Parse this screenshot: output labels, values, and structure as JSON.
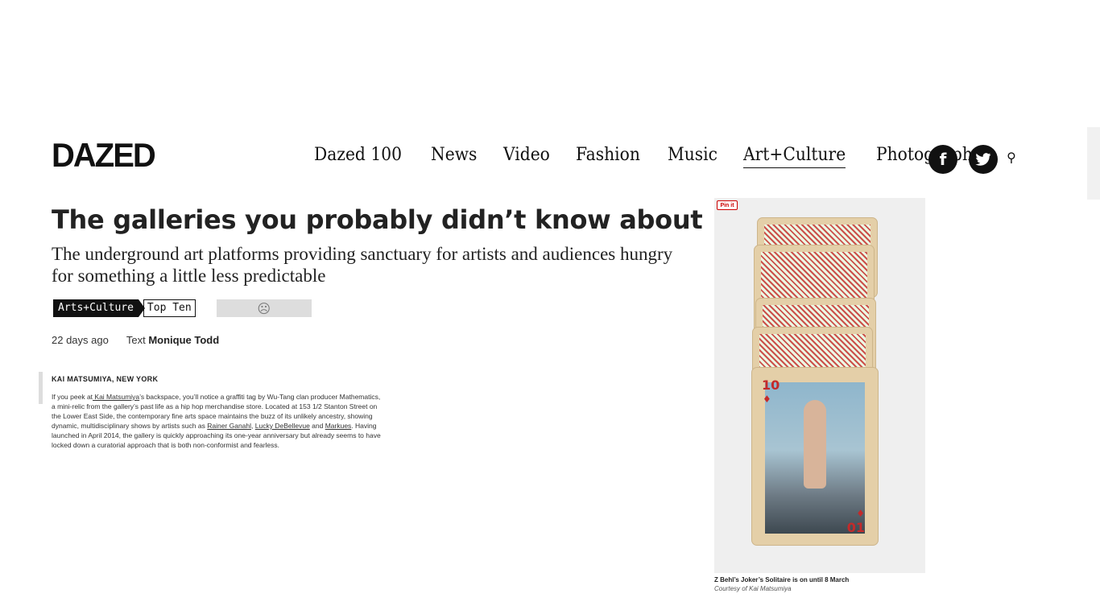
{
  "header": {
    "logo": "DAZED",
    "nav": [
      {
        "label": "Dazed 100",
        "active": false
      },
      {
        "label": "News",
        "active": false
      },
      {
        "label": "Video",
        "active": false
      },
      {
        "label": "Fashion",
        "active": false
      },
      {
        "label": "Music",
        "active": false
      },
      {
        "label": "Art+Culture",
        "active": true
      },
      {
        "label": "Photography",
        "active": false
      }
    ],
    "facebook_glyph": "f",
    "twitter_glyph": "🐦",
    "search_glyph": "⚲"
  },
  "article": {
    "headline": "The galleries you probably didn’t know about",
    "dek": "The underground art platforms providing sanctuary for artists and audiences hungry for something a little less predictable",
    "tags": {
      "primary": "Arts+Culture",
      "secondary": "Top Ten"
    },
    "ad_glyph": "☹",
    "meta": {
      "age": "22 days ago",
      "text_label": "Text",
      "author": "Monique Todd"
    },
    "section_heading": "KAI MATSUMIYA, NEW YORK",
    "body": {
      "p1": "If you peek at",
      "link1": " Kai Matsumiya",
      "p2": "’s backspace, you’ll notice a graffiti tag by Wu-Tang clan producer Mathematics, a mini-relic from the gallery’s past life as a hip hop merchandise store. Located at 153 1/2 Stanton Street on the Lower East Side, the contemporary fine arts space maintains the buzz of its unlikely ancestry, showing dynamic, multidisciplinary shows by artists such as ",
      "link2": "Rainer Ganahl",
      "p3": ", ",
      "link3": "Lucky DeBellevue",
      "p4": " and ",
      "link4": "Markues",
      "p5": ". Having launched in April 2014, the gallery is quickly approaching its one-year anniversary but already seems to have locked down a curatorial approach that is both non-conformist and fearless."
    }
  },
  "image": {
    "pin_label": "Pin it",
    "card_rank_top": "10",
    "card_rank_bottom": "01",
    "card_suit": "♦",
    "caption": "Z Behl’s Joker’s Solitaire is on until 8 March",
    "credit": "Courtesy of Kai Matsumiya"
  },
  "colors": {
    "accent": "#111111",
    "card_red": "#c83a3a",
    "tag_bg": "#111111"
  }
}
